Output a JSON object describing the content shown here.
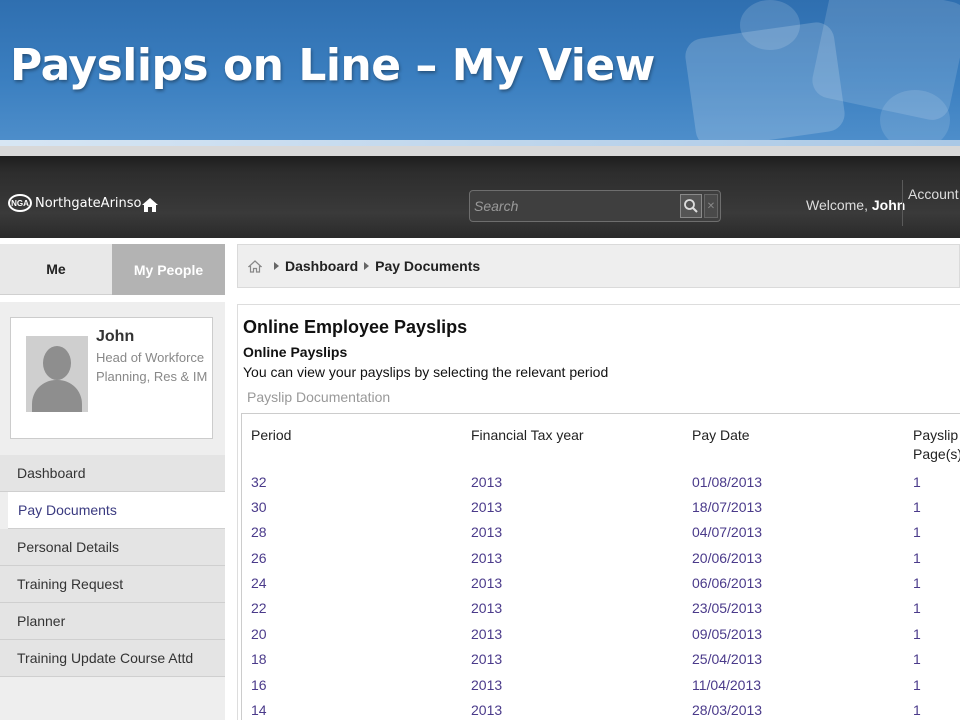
{
  "slide": {
    "title": "Payslips on Line – My View"
  },
  "appbar": {
    "logo_badge": "NGA",
    "logo_text": "NorthgateArinso",
    "search_placeholder": "Search",
    "welcome_prefix": "Welcome,",
    "welcome_user": "John",
    "account_label": "Account"
  },
  "tabs": {
    "me": "Me",
    "my_people": "My People"
  },
  "profile": {
    "name": "John",
    "role": "Head of Workforce Planning, Res & IM"
  },
  "nav": {
    "items": [
      {
        "label": "Dashboard"
      },
      {
        "label": "Pay Documents"
      },
      {
        "label": "Personal Details"
      },
      {
        "label": "Training Request"
      },
      {
        "label": "Planner"
      },
      {
        "label": "Training Update Course Attd"
      }
    ]
  },
  "breadcrumb": {
    "dashboard": "Dashboard",
    "current": "Pay Documents"
  },
  "main": {
    "title": "Online Employee Payslips",
    "subtitle": "Online Payslips",
    "description": "You can view your payslips by selecting the relevant period",
    "doc_link": "Payslip Documentation",
    "columns": [
      "Period",
      "Financial Tax year",
      "Pay Date",
      "Payslip Page(s)"
    ],
    "rows": [
      {
        "period": "32",
        "year": "2013",
        "date": "01/08/2013",
        "pages": "1"
      },
      {
        "period": "30",
        "year": "2013",
        "date": "18/07/2013",
        "pages": "1"
      },
      {
        "period": "28",
        "year": "2013",
        "date": "04/07/2013",
        "pages": "1"
      },
      {
        "period": "26",
        "year": "2013",
        "date": "20/06/2013",
        "pages": "1"
      },
      {
        "period": "24",
        "year": "2013",
        "date": "06/06/2013",
        "pages": "1"
      },
      {
        "period": "22",
        "year": "2013",
        "date": "23/05/2013",
        "pages": "1"
      },
      {
        "period": "20",
        "year": "2013",
        "date": "09/05/2013",
        "pages": "1"
      },
      {
        "period": "18",
        "year": "2013",
        "date": "25/04/2013",
        "pages": "1"
      },
      {
        "period": "16",
        "year": "2013",
        "date": "11/04/2013",
        "pages": "1"
      },
      {
        "period": "14",
        "year": "2013",
        "date": "28/03/2013",
        "pages": "1"
      }
    ]
  },
  "icons": {
    "home": "home-icon",
    "search": "magnifier-icon",
    "clear": "close-icon",
    "avatar": "person-silhouette-icon"
  }
}
